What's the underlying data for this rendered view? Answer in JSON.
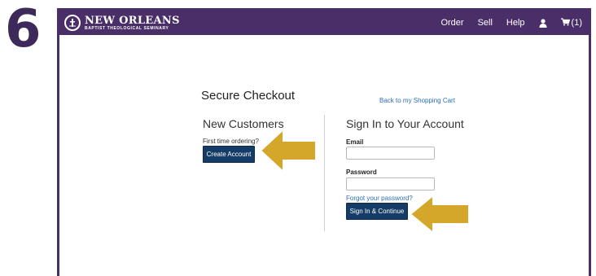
{
  "step": {
    "number": "6"
  },
  "header": {
    "logo": {
      "title": "NEW ORLEANS",
      "subtitle": "BAPTIST THEOLOGICAL SEMINARY",
      "icon": "seminary-seal-icon"
    },
    "nav": {
      "order_label": "Order",
      "sell_label": "Sell",
      "help_label": "Help",
      "account_icon": "user-icon",
      "cart_icon": "cart-icon",
      "cart_count": "(1)"
    }
  },
  "checkout": {
    "heading": "Secure Checkout",
    "back_link": "Back to my Shopping Cart",
    "new_customers": {
      "heading": "New Customers",
      "prompt": "First time ordering?",
      "button_label": "Create Account"
    },
    "sign_in": {
      "heading": "Sign In to Your Account",
      "email_label": "Email",
      "email_value": "",
      "password_label": "Password",
      "password_value": "",
      "forgot_link": "Forgot your password?",
      "button_label": "Sign In & Continue"
    }
  },
  "colors": {
    "navbar": "#4a2e68",
    "button": "#143c66",
    "link": "#2a6fb8",
    "arrow": "#d4a62a"
  }
}
